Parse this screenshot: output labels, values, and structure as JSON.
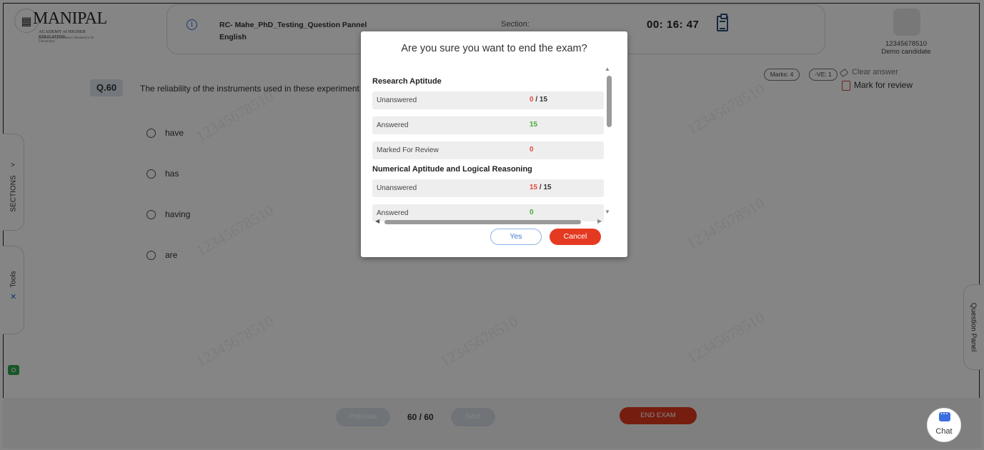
{
  "header": {
    "logo": {
      "name": "MANIPAL",
      "subline1": "ACADEMY of HIGHER EDUCATION",
      "subline2": "(Institution of Eminence Deemed to be University)"
    },
    "exam_name": "RC- Mahe_PhD_Testing_Question Pannel",
    "language": "English",
    "section_label": "Section:",
    "timer": "00: 16: 47"
  },
  "candidate": {
    "id": "12345678510",
    "name": "Demo candidate"
  },
  "question": {
    "number": "Q.60",
    "text": "The reliability of the instruments used in these experiment",
    "options": [
      "have",
      "has",
      "having",
      "are"
    ],
    "marks": "Marks: 4",
    "negative": "-VE: 1",
    "clear_answer": "Clear answer",
    "mark_for_review": "Mark for review"
  },
  "side_tabs": {
    "sections": "SECTIONS",
    "sections_arrow": ">",
    "tools": "Tools",
    "question_panel": "Question Panel"
  },
  "watermark": "12345678510",
  "footer": {
    "previous": "Previous",
    "page": "60 / 60",
    "next": "Next",
    "end_exam": "END EXAM",
    "chat": "Chat"
  },
  "modal": {
    "title": "Are you sure you want to end the exam?",
    "groups": [
      {
        "name": "Research Aptitude",
        "rows": [
          {
            "label": "Unanswered",
            "value": "0",
            "total": "/ 15"
          },
          {
            "label": "Answered",
            "value": "15",
            "total": ""
          },
          {
            "label": "Marked For Review",
            "value": "0",
            "total": ""
          }
        ]
      },
      {
        "name": "Numerical Aptitude and Logical Reasoning",
        "rows": [
          {
            "label": "Unanswered",
            "value": "15",
            "total": "/ 15"
          },
          {
            "label": "Answered",
            "value": "0",
            "total": ""
          }
        ]
      }
    ],
    "yes": "Yes",
    "cancel": "Cancel"
  },
  "colors": {
    "accent_red": "#e53a22",
    "accent_blue": "#3d78d9",
    "value_red": "#e44b3a",
    "value_green": "#4aa83a"
  }
}
